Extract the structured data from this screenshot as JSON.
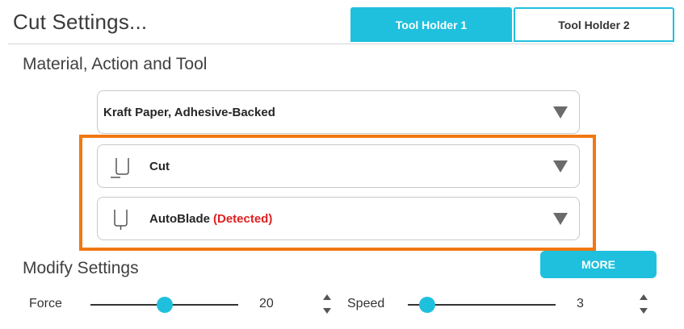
{
  "header": {
    "title": "Cut Settings...",
    "tabs": [
      {
        "label": "Tool Holder 1",
        "active": true
      },
      {
        "label": "Tool Holder 2",
        "active": false
      }
    ]
  },
  "material_section": {
    "label": "Material, Action and Tool",
    "material": {
      "value": "Kraft Paper, Adhesive-Backed",
      "icon": "chevron-down-icon"
    },
    "action": {
      "value": "Cut",
      "icon": "cut-action-icon"
    },
    "tool": {
      "value": "AutoBlade",
      "status": "(Detected)",
      "icon": "autoblade-icon"
    }
  },
  "modify_section": {
    "label": "Modify Settings",
    "more_label": "MORE",
    "force": {
      "label": "Force",
      "value": "20",
      "level": 0.5
    },
    "speed": {
      "label": "Speed",
      "value": "3",
      "level": 0.13
    }
  },
  "colors": {
    "accent": "#1fc0dd",
    "highlight": "#f07812",
    "detected": "#e02020"
  }
}
